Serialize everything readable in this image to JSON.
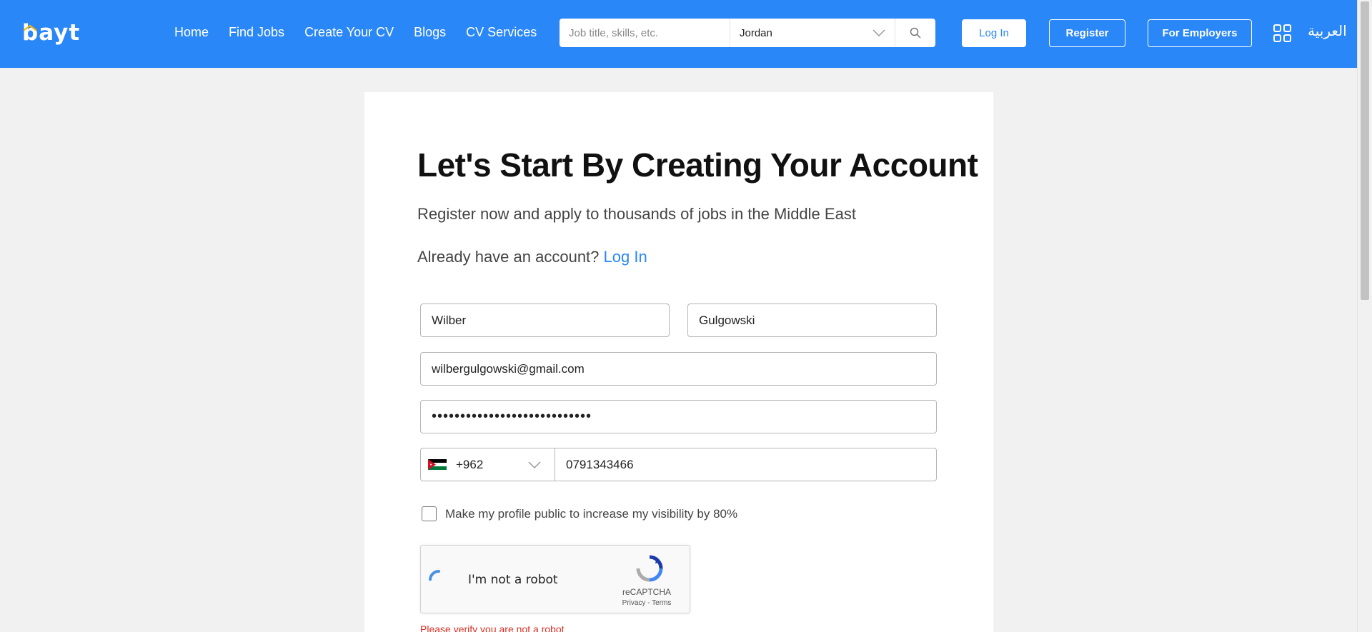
{
  "header": {
    "logo_text": "bayt",
    "nav": [
      "Home",
      "Find Jobs",
      "Create Your CV",
      "Blogs",
      "CV Services"
    ],
    "search_placeholder": "Job title, skills, etc.",
    "country": "Jordan",
    "login_label": "Log In",
    "register_label": "Register",
    "employers_label": "For Employers",
    "language_label": "العربية"
  },
  "form": {
    "title": "Let's Start By Creating Your Account",
    "subtitle": "Register now and apply to thousands of jobs in the Middle East",
    "already_text": "Already have an account?",
    "login_link": "Log In",
    "first_name": "Wilber",
    "last_name": "Gulgowski",
    "email": "wilbergulgowski@gmail.com",
    "password_mask": "••••••••••••••••••••••••••••",
    "dial_code": "+962",
    "phone": "0791343466",
    "public_profile_label": "Make my profile public to increase my visibility by 80%",
    "captcha_label": "I'm not a robot",
    "captcha_brand": "reCAPTCHA",
    "captcha_links": "Privacy - Terms",
    "captcha_error": "Please verify you are not a robot"
  },
  "colors": {
    "brand_blue": "#2a87f8",
    "logo_accent": "#f5b800",
    "error_red": "#d93025"
  }
}
